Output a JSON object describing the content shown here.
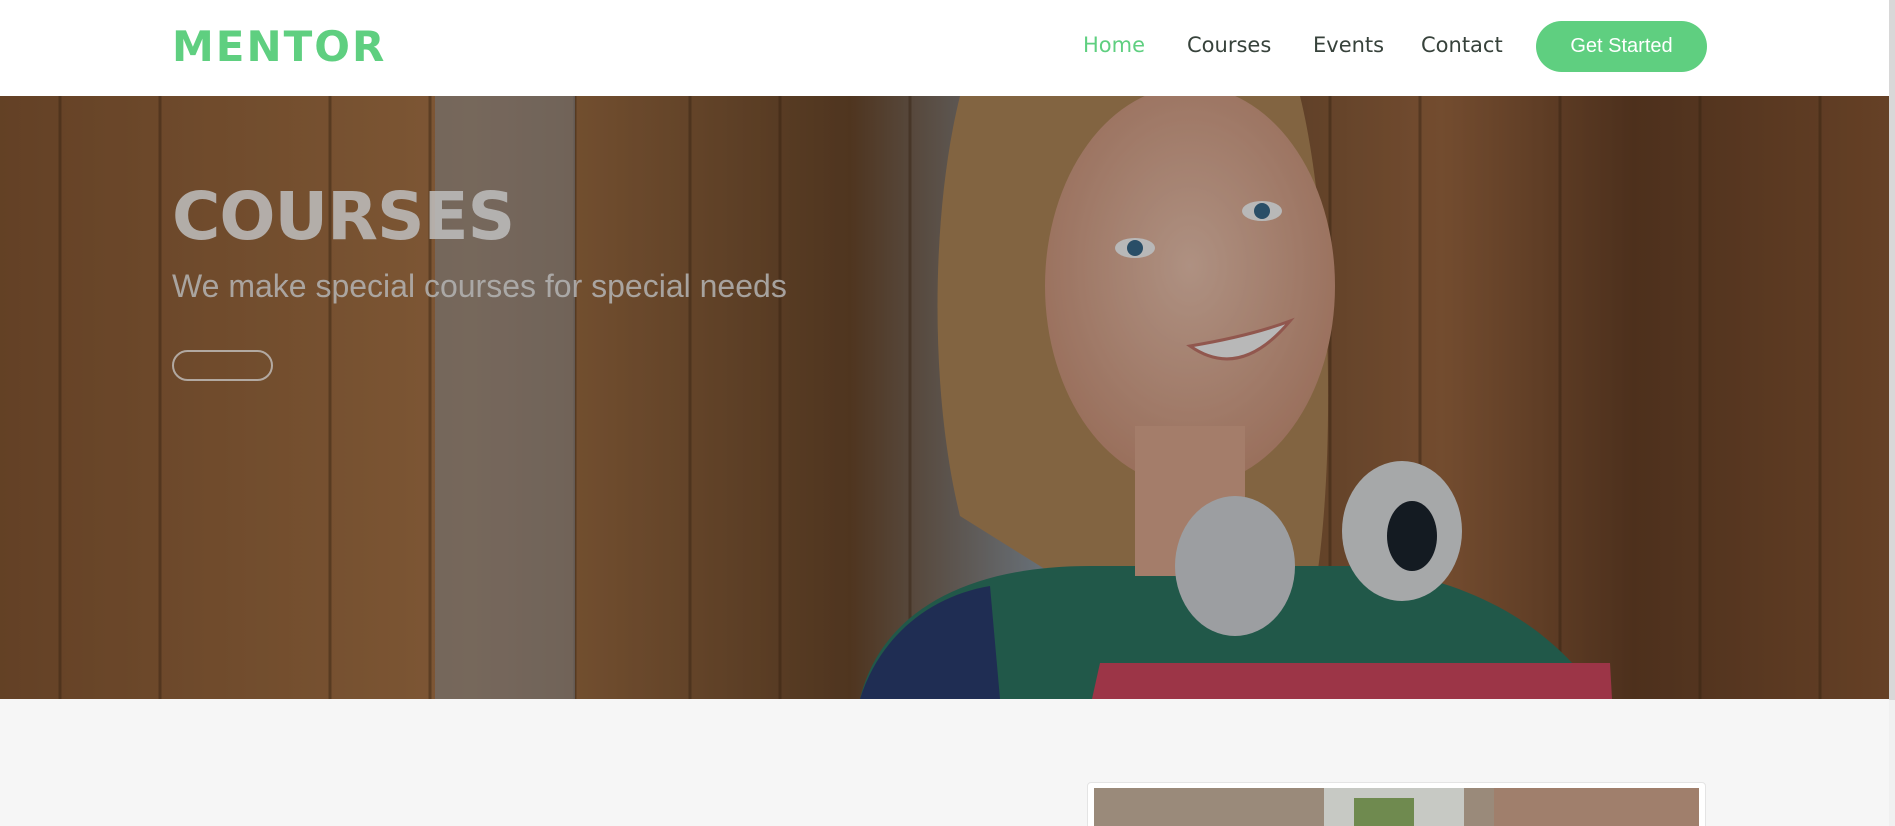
{
  "header": {
    "logo": "MENTOR",
    "nav": [
      {
        "label": "Home",
        "active": true
      },
      {
        "label": "Courses",
        "active": false
      },
      {
        "label": "Events",
        "active": false
      },
      {
        "label": "Contact",
        "active": false
      }
    ],
    "cta_label": "Get Started"
  },
  "hero": {
    "title": "COURSES",
    "subtitle": "We make special courses for special needs",
    "button_label": ""
  },
  "colors": {
    "accent": "#5fcf80",
    "nav_text": "#37423b",
    "page_background": "#f6f6f6"
  }
}
